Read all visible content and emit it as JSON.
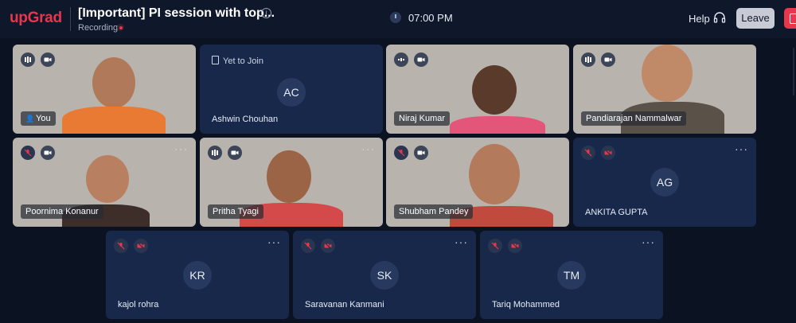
{
  "app": {
    "logo": "upGrad"
  },
  "header": {
    "title": "[Important] PI session with top...",
    "recording_label": "Recording",
    "time": "07:00 PM",
    "help_label": "Help",
    "leave_label": "Leave"
  },
  "participants": [
    {
      "label": "You",
      "state": "video",
      "mic": "on",
      "camera": "on"
    },
    {
      "label": "Ashwin Chouhan",
      "initials": "AC",
      "status": "Yet to Join",
      "state": "avatar"
    },
    {
      "label": "Niraj Kumar",
      "state": "video",
      "mic": "on",
      "camera": "on"
    },
    {
      "label": "Pandiarajan Nammalwar",
      "state": "video",
      "mic": "on",
      "camera": "on"
    },
    {
      "label": "Poornima Konanur",
      "state": "video",
      "mic": "muted",
      "camera": "on"
    },
    {
      "label": "Pritha Tyagi",
      "state": "video",
      "mic": "on",
      "camera": "on"
    },
    {
      "label": "Shubham Pandey",
      "state": "video",
      "mic": "muted",
      "camera": "on"
    },
    {
      "label": "ANKITA GUPTA",
      "initials": "AG",
      "state": "avatar",
      "mic": "muted",
      "camera": "off"
    },
    {
      "label": "kajol rohra",
      "initials": "KR",
      "state": "avatar",
      "mic": "muted",
      "camera": "off"
    },
    {
      "label": "Saravanan Kanmani",
      "initials": "SK",
      "state": "avatar",
      "mic": "muted",
      "camera": "off"
    },
    {
      "label": "Tariq Mohammed",
      "initials": "TM",
      "state": "avatar",
      "mic": "muted",
      "camera": "off"
    }
  ],
  "colors": {
    "brand": "#e8364c",
    "tile_bg": "#17284b",
    "page_bg": "#0b1222",
    "mute_red": "#e8364c"
  },
  "icons": [
    "info-icon",
    "recording-dot-icon",
    "clock-icon",
    "headset-icon",
    "exit-icon",
    "audio-level-icon",
    "camera-icon",
    "mic-muted-icon",
    "camera-off-icon",
    "more-options-icon",
    "document-icon",
    "speaker-icon"
  ]
}
